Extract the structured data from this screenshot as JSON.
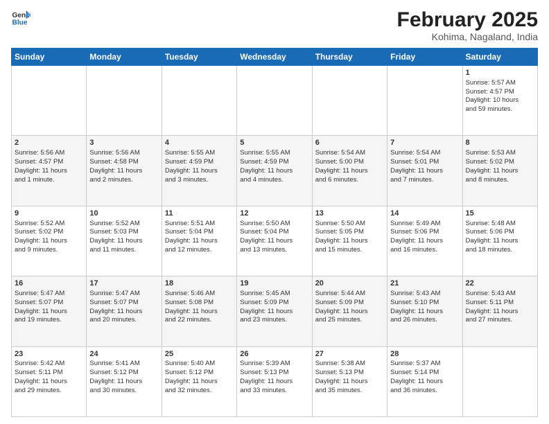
{
  "header": {
    "logo_line1": "General",
    "logo_line2": "Blue",
    "month": "February 2025",
    "location": "Kohima, Nagaland, India"
  },
  "days_of_week": [
    "Sunday",
    "Monday",
    "Tuesday",
    "Wednesday",
    "Thursday",
    "Friday",
    "Saturday"
  ],
  "weeks": [
    [
      {
        "day": "",
        "info": ""
      },
      {
        "day": "",
        "info": ""
      },
      {
        "day": "",
        "info": ""
      },
      {
        "day": "",
        "info": ""
      },
      {
        "day": "",
        "info": ""
      },
      {
        "day": "",
        "info": ""
      },
      {
        "day": "1",
        "info": "Sunrise: 5:57 AM\nSunset: 4:57 PM\nDaylight: 10 hours\nand 59 minutes."
      }
    ],
    [
      {
        "day": "2",
        "info": "Sunrise: 5:56 AM\nSunset: 4:57 PM\nDaylight: 11 hours\nand 1 minute."
      },
      {
        "day": "3",
        "info": "Sunrise: 5:56 AM\nSunset: 4:58 PM\nDaylight: 11 hours\nand 2 minutes."
      },
      {
        "day": "4",
        "info": "Sunrise: 5:55 AM\nSunset: 4:59 PM\nDaylight: 11 hours\nand 3 minutes."
      },
      {
        "day": "5",
        "info": "Sunrise: 5:55 AM\nSunset: 4:59 PM\nDaylight: 11 hours\nand 4 minutes."
      },
      {
        "day": "6",
        "info": "Sunrise: 5:54 AM\nSunset: 5:00 PM\nDaylight: 11 hours\nand 6 minutes."
      },
      {
        "day": "7",
        "info": "Sunrise: 5:54 AM\nSunset: 5:01 PM\nDaylight: 11 hours\nand 7 minutes."
      },
      {
        "day": "8",
        "info": "Sunrise: 5:53 AM\nSunset: 5:02 PM\nDaylight: 11 hours\nand 8 minutes."
      }
    ],
    [
      {
        "day": "9",
        "info": "Sunrise: 5:52 AM\nSunset: 5:02 PM\nDaylight: 11 hours\nand 9 minutes."
      },
      {
        "day": "10",
        "info": "Sunrise: 5:52 AM\nSunset: 5:03 PM\nDaylight: 11 hours\nand 11 minutes."
      },
      {
        "day": "11",
        "info": "Sunrise: 5:51 AM\nSunset: 5:04 PM\nDaylight: 11 hours\nand 12 minutes."
      },
      {
        "day": "12",
        "info": "Sunrise: 5:50 AM\nSunset: 5:04 PM\nDaylight: 11 hours\nand 13 minutes."
      },
      {
        "day": "13",
        "info": "Sunrise: 5:50 AM\nSunset: 5:05 PM\nDaylight: 11 hours\nand 15 minutes."
      },
      {
        "day": "14",
        "info": "Sunrise: 5:49 AM\nSunset: 5:06 PM\nDaylight: 11 hours\nand 16 minutes."
      },
      {
        "day": "15",
        "info": "Sunrise: 5:48 AM\nSunset: 5:06 PM\nDaylight: 11 hours\nand 18 minutes."
      }
    ],
    [
      {
        "day": "16",
        "info": "Sunrise: 5:47 AM\nSunset: 5:07 PM\nDaylight: 11 hours\nand 19 minutes."
      },
      {
        "day": "17",
        "info": "Sunrise: 5:47 AM\nSunset: 5:07 PM\nDaylight: 11 hours\nand 20 minutes."
      },
      {
        "day": "18",
        "info": "Sunrise: 5:46 AM\nSunset: 5:08 PM\nDaylight: 11 hours\nand 22 minutes."
      },
      {
        "day": "19",
        "info": "Sunrise: 5:45 AM\nSunset: 5:09 PM\nDaylight: 11 hours\nand 23 minutes."
      },
      {
        "day": "20",
        "info": "Sunrise: 5:44 AM\nSunset: 5:09 PM\nDaylight: 11 hours\nand 25 minutes."
      },
      {
        "day": "21",
        "info": "Sunrise: 5:43 AM\nSunset: 5:10 PM\nDaylight: 11 hours\nand 26 minutes."
      },
      {
        "day": "22",
        "info": "Sunrise: 5:43 AM\nSunset: 5:11 PM\nDaylight: 11 hours\nand 27 minutes."
      }
    ],
    [
      {
        "day": "23",
        "info": "Sunrise: 5:42 AM\nSunset: 5:11 PM\nDaylight: 11 hours\nand 29 minutes."
      },
      {
        "day": "24",
        "info": "Sunrise: 5:41 AM\nSunset: 5:12 PM\nDaylight: 11 hours\nand 30 minutes."
      },
      {
        "day": "25",
        "info": "Sunrise: 5:40 AM\nSunset: 5:12 PM\nDaylight: 11 hours\nand 32 minutes."
      },
      {
        "day": "26",
        "info": "Sunrise: 5:39 AM\nSunset: 5:13 PM\nDaylight: 11 hours\nand 33 minutes."
      },
      {
        "day": "27",
        "info": "Sunrise: 5:38 AM\nSunset: 5:13 PM\nDaylight: 11 hours\nand 35 minutes."
      },
      {
        "day": "28",
        "info": "Sunrise: 5:37 AM\nSunset: 5:14 PM\nDaylight: 11 hours\nand 36 minutes."
      },
      {
        "day": "",
        "info": ""
      }
    ]
  ]
}
